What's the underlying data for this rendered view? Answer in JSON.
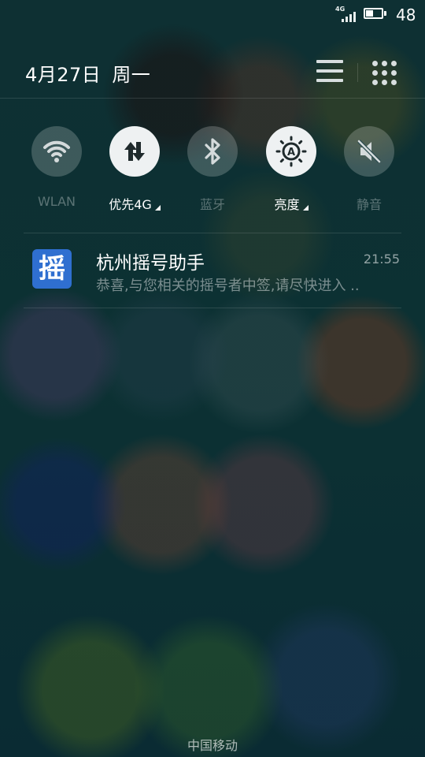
{
  "status_bar": {
    "network_type": "4G",
    "battery_percent": "48",
    "battery_level": 0.48
  },
  "header": {
    "date": "4月27日",
    "weekday": "周一",
    "icons": [
      "list-icon",
      "grid-apps-icon"
    ]
  },
  "quick_toggles": [
    {
      "label": "WLAN",
      "icon": "wifi-icon",
      "active": false
    },
    {
      "label": "优先4G",
      "icon": "mobile-data-icon",
      "active": true,
      "expandable": true
    },
    {
      "label": "蓝牙",
      "icon": "bluetooth-icon",
      "active": false
    },
    {
      "label": "亮度",
      "icon": "brightness-auto-icon",
      "active": true,
      "expandable": true
    },
    {
      "label": "静音",
      "icon": "mute-icon",
      "active": false
    }
  ],
  "notification": {
    "app_icon_char": "摇",
    "title": "杭州摇号助手",
    "time": "21:55",
    "body": "恭喜,与您相关的摇号者中签,请尽快进入 .."
  },
  "carrier": "中国移动",
  "colors": {
    "background": "#0b2f33",
    "toggle_on": "#eef1f2",
    "app_icon": "#2f6fd0"
  }
}
